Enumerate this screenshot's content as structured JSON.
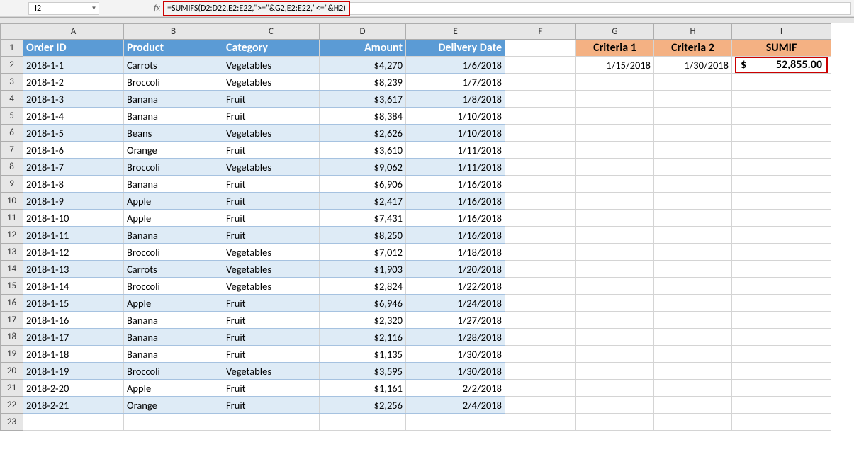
{
  "namebox": "I2",
  "formula": "=SUMIFS(D2:D22,E2:E22,\">=\"&G2,E2:E22,\"<=\"&H2)",
  "fx_label": "fx",
  "columns": [
    "A",
    "B",
    "C",
    "D",
    "E",
    "F",
    "G",
    "H",
    "I"
  ],
  "rownums": [
    "1",
    "2",
    "3",
    "4",
    "5",
    "6",
    "7",
    "8",
    "9",
    "10",
    "11",
    "12",
    "13",
    "14",
    "15",
    "16",
    "17",
    "18",
    "19",
    "20",
    "21",
    "22",
    "23"
  ],
  "headers": {
    "orderid": "Order ID",
    "product": "Product",
    "category": "Category",
    "amount": "Amount",
    "delivery": "Delivery Date",
    "criteria1": "Criteria 1",
    "criteria2": "Criteria 2",
    "sumif": "SUMIF"
  },
  "criteria": {
    "g2": "1/15/2018",
    "h2": "1/30/2018"
  },
  "result_currency": "$",
  "result_value": "52,855.00",
  "rows": [
    {
      "id": "2018-1-1",
      "product": "Carrots",
      "category": "Vegetables",
      "amount": "$4,270",
      "date": "1/6/2018"
    },
    {
      "id": "2018-1-2",
      "product": "Broccoli",
      "category": "Vegetables",
      "amount": "$8,239",
      "date": "1/7/2018"
    },
    {
      "id": "2018-1-3",
      "product": "Banana",
      "category": "Fruit",
      "amount": "$3,617",
      "date": "1/8/2018"
    },
    {
      "id": "2018-1-4",
      "product": "Banana",
      "category": "Fruit",
      "amount": "$8,384",
      "date": "1/10/2018"
    },
    {
      "id": "2018-1-5",
      "product": "Beans",
      "category": "Vegetables",
      "amount": "$2,626",
      "date": "1/10/2018"
    },
    {
      "id": "2018-1-6",
      "product": "Orange",
      "category": "Fruit",
      "amount": "$3,610",
      "date": "1/11/2018"
    },
    {
      "id": "2018-1-7",
      "product": "Broccoli",
      "category": "Vegetables",
      "amount": "$9,062",
      "date": "1/11/2018"
    },
    {
      "id": "2018-1-8",
      "product": "Banana",
      "category": "Fruit",
      "amount": "$6,906",
      "date": "1/16/2018"
    },
    {
      "id": "2018-1-9",
      "product": "Apple",
      "category": "Fruit",
      "amount": "$2,417",
      "date": "1/16/2018"
    },
    {
      "id": "2018-1-10",
      "product": "Apple",
      "category": "Fruit",
      "amount": "$7,431",
      "date": "1/16/2018"
    },
    {
      "id": "2018-1-11",
      "product": "Banana",
      "category": "Fruit",
      "amount": "$8,250",
      "date": "1/16/2018"
    },
    {
      "id": "2018-1-12",
      "product": "Broccoli",
      "category": "Vegetables",
      "amount": "$7,012",
      "date": "1/18/2018"
    },
    {
      "id": "2018-1-13",
      "product": "Carrots",
      "category": "Vegetables",
      "amount": "$1,903",
      "date": "1/20/2018"
    },
    {
      "id": "2018-1-14",
      "product": "Broccoli",
      "category": "Vegetables",
      "amount": "$2,824",
      "date": "1/22/2018"
    },
    {
      "id": "2018-1-15",
      "product": "Apple",
      "category": "Fruit",
      "amount": "$6,946",
      "date": "1/24/2018"
    },
    {
      "id": "2018-1-16",
      "product": "Banana",
      "category": "Fruit",
      "amount": "$2,320",
      "date": "1/27/2018"
    },
    {
      "id": "2018-1-17",
      "product": "Banana",
      "category": "Fruit",
      "amount": "$2,116",
      "date": "1/28/2018"
    },
    {
      "id": "2018-1-18",
      "product": "Banana",
      "category": "Fruit",
      "amount": "$1,135",
      "date": "1/30/2018"
    },
    {
      "id": "2018-1-19",
      "product": "Broccoli",
      "category": "Vegetables",
      "amount": "$3,595",
      "date": "1/30/2018"
    },
    {
      "id": "2018-2-20",
      "product": "Apple",
      "category": "Fruit",
      "amount": "$1,161",
      "date": "2/2/2018"
    },
    {
      "id": "2018-2-21",
      "product": "Orange",
      "category": "Fruit",
      "amount": "$2,256",
      "date": "2/4/2018"
    }
  ]
}
